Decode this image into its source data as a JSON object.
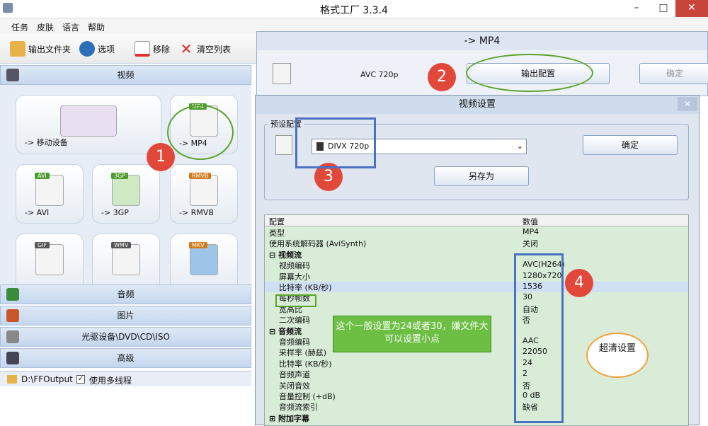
{
  "app": {
    "title": "格式工厂 3.3.4",
    "min": "–",
    "max": "□",
    "close": "✕"
  },
  "menu": [
    "任务",
    "皮肤",
    "语言",
    "帮助"
  ],
  "toolbar": {
    "output_folder": "输出文件夹",
    "options": "选项",
    "remove": "移除",
    "clear": "清空列表"
  },
  "sections": {
    "video": "视频",
    "audio": "音频",
    "picture": "图片",
    "rom": "光驱设备\\DVD\\CD\\ISO",
    "advanced": "高级"
  },
  "tiles": [
    {
      "label": "-> 移动设备"
    },
    {
      "label": "-> MP4",
      "tag": "MP4"
    },
    {
      "label": "-> AVI",
      "tag": "AVI"
    },
    {
      "label": "-> 3GP",
      "tag": "3GP"
    },
    {
      "label": "-> RMVB",
      "tag": "RMVB"
    },
    {
      "label": "",
      "tag": "GIF"
    },
    {
      "label": "",
      "tag": "WMV"
    },
    {
      "label": "",
      "tag": "MKV"
    }
  ],
  "status": {
    "path": "D:\\FFOutput",
    "multithread": "使用多线程"
  },
  "mp4win": {
    "title": "-> MP4",
    "profile": "AVC 720p",
    "output_config": "输出配置",
    "ok": "确定"
  },
  "vwin": {
    "title": "视频设置",
    "preset_legend": "预设配置",
    "preset_value": "DIVX 720p",
    "ok": "确定",
    "saveas": "另存为",
    "col_config": "配置",
    "col_value": "数值",
    "rows": [
      {
        "k": "类型",
        "v": "MP4"
      },
      {
        "k": "使用系统解码器 (AviSynth)",
        "v": "关闭"
      },
      {
        "k": "⊟ 视频流",
        "v": "",
        "group": true
      },
      {
        "k": "视频编码",
        "v": "AVC(H264)"
      },
      {
        "k": "屏幕大小",
        "v": "1280x720"
      },
      {
        "k": "比特率 (KB/秒)",
        "v": "1536",
        "sel": true
      },
      {
        "k": "每秒帧数",
        "v": "30"
      },
      {
        "k": "宽高比",
        "v": "自动"
      },
      {
        "k": "二次编码",
        "v": "否"
      },
      {
        "k": "⊟ 音频流",
        "v": "",
        "group": true
      },
      {
        "k": "音频编码",
        "v": "AAC"
      },
      {
        "k": "采样率 (赫兹)",
        "v": "22050"
      },
      {
        "k": "比特率 (KB/秒)",
        "v": "24"
      },
      {
        "k": "音频声道",
        "v": "2"
      },
      {
        "k": "关闭音效",
        "v": "否"
      },
      {
        "k": "音量控制 (+dB)",
        "v": "0 dB"
      },
      {
        "k": "音频流索引",
        "v": "缺省"
      },
      {
        "k": "⊞ 附加字幕",
        "v": "",
        "group": true
      }
    ]
  },
  "annotations": {
    "n1": "1",
    "n2": "2",
    "n3": "3",
    "n4": "4",
    "note": "这个一般设置为24或者30，嫌文件大可以设置小点",
    "bubble": "超清设置"
  },
  "colors": {
    "callout": "#e2483a",
    "ring": "#5aa32c",
    "box": "#4a72c0",
    "table_bg": "#d8ecd8"
  }
}
